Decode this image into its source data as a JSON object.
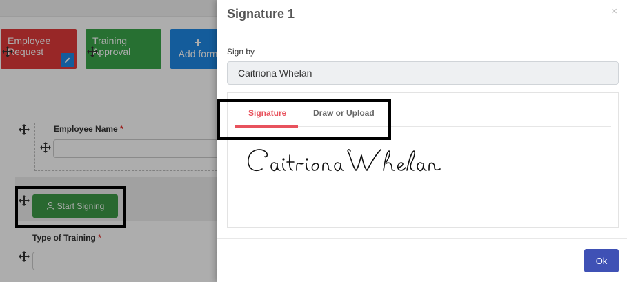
{
  "background": {
    "tiles": [
      {
        "label": "Employee Request",
        "color": "#e03a3a"
      },
      {
        "label": "Training Approval",
        "color": "#3aa54a"
      },
      {
        "label": "Add form",
        "color": "#1e88e5"
      }
    ],
    "employee_name_label": "Employee Name",
    "required_mark": "*",
    "start_signing_label": "Start Signing",
    "type_of_training_label": "Type of Training"
  },
  "modal": {
    "title": "Signature 1",
    "close_glyph": "×",
    "sign_by_label": "Sign by",
    "sign_by_value": "Caitriona Whelan",
    "tabs": [
      {
        "label": "Signature",
        "active": true
      },
      {
        "label": "Draw or Upload",
        "active": false
      }
    ],
    "signature_text": "Caitriona Whelan",
    "ok_label": "Ok",
    "accent_color": "#e8525d",
    "ok_color": "#3f51b5"
  }
}
